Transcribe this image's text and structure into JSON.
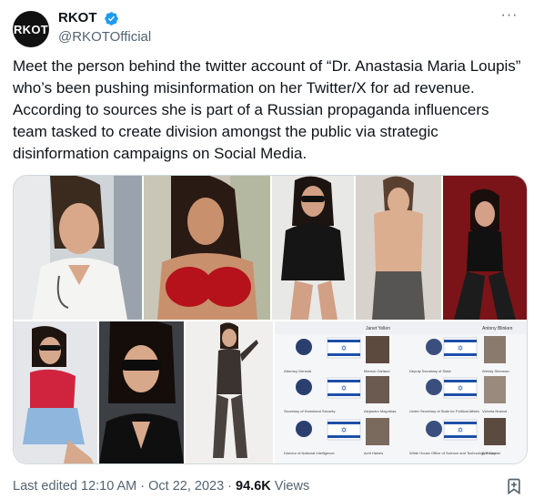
{
  "account": {
    "avatar_text": "RKOT",
    "display_name": "RKOT",
    "handle": "@RKOTOfficial",
    "verified_color": "#1d9bf0"
  },
  "tweet": {
    "text": "Meet the person behind the twitter account of “Dr. Anastasia Maria Loupis” who’s been pushing misinformation on her Twitter/X for ad revenue. According to sources she is part of a Russian propaganda influencers team tasked to create division amongst the public via strategic disinformation campaigns on Social Media."
  },
  "media": {
    "org_chart": {
      "top_left_name": "Janet Yellen",
      "top_right_name": "Antony Blinken",
      "rows": [
        {
          "left_title": "Attorney General",
          "left_person": "Merrick Garland",
          "right_title": "Deputy Secretary of State",
          "right_person": "Wendy Sherman"
        },
        {
          "left_title": "Secretary of Homeland Security",
          "left_person": "Alejandro Mayorkas",
          "right_title": "Under Secretary of State for Political Affairs",
          "right_person": "Victoria Nuland"
        },
        {
          "left_title": "Director of National Intelligence",
          "left_person": "Avril Haines",
          "right_title": "White House Office of Science and Technology Policy",
          "right_person": "Eric Lander"
        }
      ]
    }
  },
  "footer": {
    "edited": "Last edited 12:10 AM · Oct 22, 2023 · ",
    "views_count": "94.6K",
    "views_label": " Views"
  },
  "colors": {
    "text": "#0f1419",
    "secondary": "#536471",
    "border": "#cfd9de",
    "accent": "#1d9bf0"
  },
  "icons": [
    "verified-badge-icon",
    "more-icon",
    "bookmark-icon"
  ]
}
